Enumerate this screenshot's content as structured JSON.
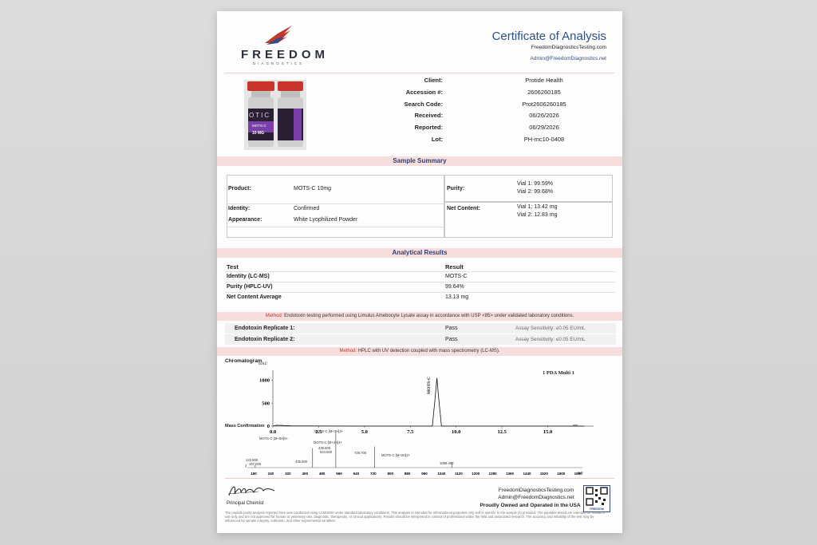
{
  "brand": {
    "name": "FREEDOM",
    "sub": "DIAGNOSTICS"
  },
  "header": {
    "title": "Certificate of Analysis",
    "website": "FreedomDiagnosticsTesting.com",
    "email": "Admin@FreedomDiagnostics.net"
  },
  "vial_label": {
    "brand_part": "OTIC",
    "product": "MOTS-C",
    "dose": "10 MG"
  },
  "info": [
    {
      "label": "Client:",
      "value": "Protide Health"
    },
    {
      "label": "Accession #:",
      "value": "2606260185"
    },
    {
      "label": "Search Code:",
      "value": "Prot2606260185"
    },
    {
      "label": "Received:",
      "value": "06/26/2026"
    },
    {
      "label": "Reported:",
      "value": "06/29/2026"
    },
    {
      "label": "Lot:",
      "value": "PH-mc10-0408"
    }
  ],
  "sample_summary": {
    "title": "Sample Summary",
    "product_label": "Product:",
    "product_value": "MOTS-C 10mg",
    "identity_label": "Identity:",
    "identity_value": "Confirmed",
    "appearance_label": "Appearance:",
    "appearance_value": "White Lyophilized Powder",
    "purity_label": "Purity:",
    "purity_v1": "Vial 1: 99.59%",
    "purity_v2": "Vial 2: 99.68%",
    "net_label": "Net Content:",
    "net_v1": "Vial 1: 13.42 mg",
    "net_v2": "Vial 2: 12.83 mg"
  },
  "analytical": {
    "title": "Analytical Results",
    "col_test": "Test",
    "col_result": "Result",
    "rows": [
      {
        "test": "Identity (LC-MS)",
        "result": "MOTS-C"
      },
      {
        "test": "Purity (HPLC-UV)",
        "result": "99.64%"
      },
      {
        "test": "Net Content Average",
        "result": "13.13 mg"
      }
    ]
  },
  "method1": {
    "label": "Method:",
    "text": "Endotoxin testing performed using Limulus Amebocyte Lysate assay in accordance with USP <85> under validated laboratory conditions."
  },
  "endotoxin": [
    {
      "label": "Endotoxin Replicate 1:",
      "result": "Pass",
      "sensitivity": "Assay Sensitivity: ≤0.05 EU/mL"
    },
    {
      "label": "Endotoxin Replicate 2:",
      "result": "Pass",
      "sensitivity": "Assay Sensitivity: ≤0.05 EU/mL"
    }
  ],
  "method2": {
    "label": "Method:",
    "text": "HPLC with UV detection coupled with mass spectrometry (LC-MS)."
  },
  "chromatogram": {
    "title": "Chromatogram",
    "y_unit": "mAU",
    "legend": "1 PDA Multi 1",
    "peak_label": "MOTS-C",
    "x_unit": "min"
  },
  "mass": {
    "title": "Mass Confirmation",
    "peaks": [
      {
        "label": "MOTS-C [M+3H]3+"
      },
      {
        "label": "MOTS-C [M+4H]4+"
      },
      {
        "label": "MOTS-C [M+5H]5+"
      },
      {
        "label": "MOTS-C [M+2H]2+"
      }
    ],
    "values": [
      "435.600",
      "544.500",
      "725.700",
      "1088.400",
      "167.000",
      "122.900",
      "435.600"
    ],
    "unit": "m/z"
  },
  "chart_data": [
    {
      "type": "line",
      "title": "Chromatogram",
      "ylabel": "mAU",
      "xlabel": "min",
      "x_ticks": [
        "0.0",
        "2.5",
        "5.0",
        "7.5",
        "10.0",
        "12.5",
        "15.0"
      ],
      "y_ticks": [
        "0",
        "500",
        "1000"
      ],
      "xlim": [
        0,
        17.5
      ],
      "ylim": [
        0,
        1150
      ],
      "series": [
        {
          "name": "1 PDA Multi 1",
          "x": [
            0.0,
            0.2,
            1.0,
            5.0,
            8.7,
            8.85,
            8.95,
            9.05,
            9.2,
            12.0,
            17.0
          ],
          "y": [
            0,
            20,
            5,
            0,
            0,
            600,
            1050,
            600,
            0,
            0,
            0
          ]
        }
      ],
      "annotations": [
        "MOTS-C"
      ]
    },
    {
      "type": "bar",
      "title": "Mass Confirmation",
      "xlabel": "m/z",
      "x_ticks": [
        "160",
        "240",
        "320",
        "400",
        "480",
        "560",
        "640",
        "720",
        "800",
        "880",
        "960",
        "1040",
        "1120",
        "1200",
        "1280",
        "1360",
        "1440",
        "1520",
        "1600",
        "1680"
      ],
      "xlim": [
        130,
        1700
      ],
      "peaks": [
        {
          "mz": 122.9,
          "intensity": 0.1
        },
        {
          "mz": 167.0,
          "intensity": 0.08
        },
        {
          "mz": 435.6,
          "intensity": 0.55
        },
        {
          "mz": 544.5,
          "intensity": 1.0
        },
        {
          "mz": 725.7,
          "intensity": 0.6
        },
        {
          "mz": 1088.4,
          "intensity": 0.15
        }
      ]
    }
  ],
  "footer": {
    "website": "FreedomDiagnosticsTesting.com",
    "email": "Admin@FreedomDiagnostics.net",
    "tagline": "Proudly Owned and Operated in the USA",
    "signer_role": "Principal Chemist",
    "qr_label": "FREEDOM",
    "fine_print": "The peptide purity analysis reported here was conducted using LCMS/MS under standard laboratory conditions. This analysis is intended for informational purposes only and is specific to the sample (s) provided. The peptides tested are intended for research use only and are not approved for human or veterinary use, diagnostic, therapeutic, or clinical applications. Results should be interpreted in context of professional within the field and associated research. The accuracy and reliability of the test may be influenced by sample integrity, collection, and other experimental variables."
  },
  "colors": {
    "accent": "#2e4f87",
    "band": "#f7dede",
    "brand_red": "#c0392b"
  }
}
